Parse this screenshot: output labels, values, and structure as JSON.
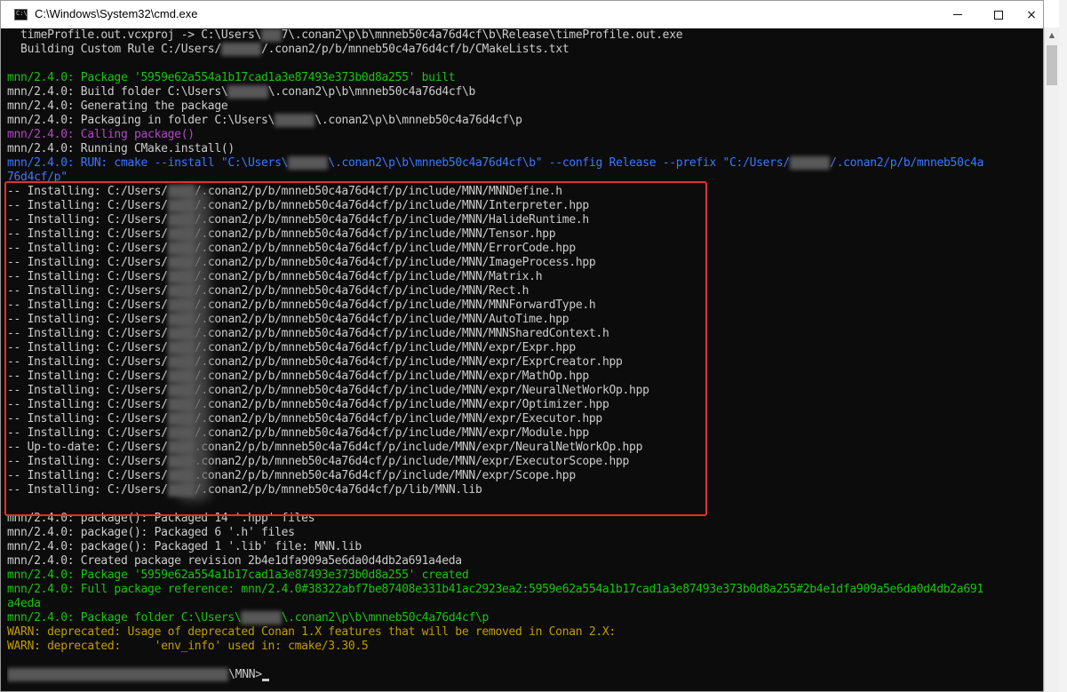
{
  "window": {
    "title": "C:\\Windows\\System32\\cmd.exe",
    "icon_label": "C:\\",
    "controls": {
      "minimize": "minimize-icon",
      "maximize": "maximize-icon",
      "close": "×"
    }
  },
  "console": {
    "lines": [
      [
        {
          "t": "  timeProfile.out.vcxproj -> C:\\Users\\",
          "c": "gray"
        },
        {
          "b": 3
        },
        {
          "t": "7\\.conan2\\p\\b\\mnneb50c4a76d4cf\\b\\Release\\timeProfile.out.exe",
          "c": "gray"
        }
      ],
      [
        {
          "t": "  Building Custom Rule C:/Users/",
          "c": "gray"
        },
        {
          "b": 6
        },
        {
          "t": "/.conan2/p/b/mnneb50c4a76d4cf/b/CMakeLists.txt",
          "c": "gray"
        }
      ],
      [],
      [
        {
          "t": "mnn/2.4.0: Package '5959e62a554a1b17cad1a3e87493e373b0d8a255' built",
          "c": "green"
        }
      ],
      [
        {
          "t": "mnn/2.4.0: Build folder C:\\Users\\",
          "c": "gray"
        },
        {
          "b": 6
        },
        {
          "t": "\\.conan2\\p\\b\\mnneb50c4a76d4cf\\b",
          "c": "gray"
        }
      ],
      [
        {
          "t": "mnn/2.4.0: Generating the package",
          "c": "gray"
        }
      ],
      [
        {
          "t": "mnn/2.4.0: Packaging in folder C:\\Users\\",
          "c": "gray"
        },
        {
          "b": 6
        },
        {
          "t": "\\.conan2\\p\\b\\mnneb50c4a76d4cf\\p",
          "c": "gray"
        }
      ],
      [
        {
          "t": "mnn/2.4.0: Calling package()",
          "c": "purple"
        }
      ],
      [
        {
          "t": "mnn/2.4.0: Running CMake.install()",
          "c": "gray"
        }
      ],
      [
        {
          "t": "mnn/2.4.0: RUN: cmake --install \"C:\\Users\\",
          "c": "blue"
        },
        {
          "b": 6
        },
        {
          "t": "\\.conan2\\p\\b\\mnneb50c4a76d4cf\\b\" --config Release --prefix \"C:/Users/",
          "c": "blue"
        },
        {
          "b": 6
        },
        {
          "t": "/.conan2/p/b/mnneb50c4a",
          "c": "blue"
        }
      ],
      [
        {
          "t": "76d4cf/p\"",
          "c": "blue"
        }
      ],
      [
        {
          "t": "-- Installing: C:/Users/",
          "c": "gray"
        },
        {
          "b": 4
        },
        {
          "t": "/.conan2/p/b/mnneb50c4a76d4cf/p/include/MNN/MNNDefine.h",
          "c": "gray"
        }
      ],
      [
        {
          "t": "-- Installing: C:/Users/",
          "c": "gray"
        },
        {
          "b": 4
        },
        {
          "t": "/.conan2/p/b/mnneb50c4a76d4cf/p/include/MNN/Interpreter.hpp",
          "c": "gray"
        }
      ],
      [
        {
          "t": "-- Installing: C:/Users/",
          "c": "gray"
        },
        {
          "b": 4
        },
        {
          "t": "/.conan2/p/b/mnneb50c4a76d4cf/p/include/MNN/HalideRuntime.h",
          "c": "gray"
        }
      ],
      [
        {
          "t": "-- Installing: C:/Users/",
          "c": "gray"
        },
        {
          "b": 4
        },
        {
          "t": "/.conan2/p/b/mnneb50c4a76d4cf/p/include/MNN/Tensor.hpp",
          "c": "gray"
        }
      ],
      [
        {
          "t": "-- Installing: C:/Users/",
          "c": "gray"
        },
        {
          "b": 4
        },
        {
          "t": "/.conan2/p/b/mnneb50c4a76d4cf/p/include/MNN/ErrorCode.hpp",
          "c": "gray"
        }
      ],
      [
        {
          "t": "-- Installing: C:/Users/",
          "c": "gray"
        },
        {
          "b": 4
        },
        {
          "t": "/.conan2/p/b/mnneb50c4a76d4cf/p/include/MNN/ImageProcess.hpp",
          "c": "gray"
        }
      ],
      [
        {
          "t": "-- Installing: C:/Users/",
          "c": "gray"
        },
        {
          "b": 4
        },
        {
          "t": "/.conan2/p/b/mnneb50c4a76d4cf/p/include/MNN/Matrix.h",
          "c": "gray"
        }
      ],
      [
        {
          "t": "-- Installing: C:/Users/",
          "c": "gray"
        },
        {
          "b": 4
        },
        {
          "t": "/.conan2/p/b/mnneb50c4a76d4cf/p/include/MNN/Rect.h",
          "c": "gray"
        }
      ],
      [
        {
          "t": "-- Installing: C:/Users/",
          "c": "gray"
        },
        {
          "b": 4
        },
        {
          "t": "/.conan2/p/b/mnneb50c4a76d4cf/p/include/MNN/MNNForwardType.h",
          "c": "gray"
        }
      ],
      [
        {
          "t": "-- Installing: C:/Users/",
          "c": "gray"
        },
        {
          "b": 4
        },
        {
          "t": "/.conan2/p/b/mnneb50c4a76d4cf/p/include/MNN/AutoTime.hpp",
          "c": "gray"
        }
      ],
      [
        {
          "t": "-- Installing: C:/Users/",
          "c": "gray"
        },
        {
          "b": 4
        },
        {
          "t": "/.conan2/p/b/mnneb50c4a76d4cf/p/include/MNN/MNNSharedContext.h",
          "c": "gray"
        }
      ],
      [
        {
          "t": "-- Installing: C:/Users/",
          "c": "gray"
        },
        {
          "b": 4
        },
        {
          "t": "/.conan2/p/b/mnneb50c4a76d4cf/p/include/MNN/expr/Expr.hpp",
          "c": "gray"
        }
      ],
      [
        {
          "t": "-- Installing: C:/Users/",
          "c": "gray"
        },
        {
          "b": 4
        },
        {
          "t": "/.conan2/p/b/mnneb50c4a76d4cf/p/include/MNN/expr/ExprCreator.hpp",
          "c": "gray"
        }
      ],
      [
        {
          "t": "-- Installing: C:/Users/",
          "c": "gray"
        },
        {
          "b": 4
        },
        {
          "t": "/.conan2/p/b/mnneb50c4a76d4cf/p/include/MNN/expr/MathOp.hpp",
          "c": "gray"
        }
      ],
      [
        {
          "t": "-- Installing: C:/Users/",
          "c": "gray"
        },
        {
          "b": 4
        },
        {
          "t": "/.conan2/p/b/mnneb50c4a76d4cf/p/include/MNN/expr/NeuralNetWorkOp.hpp",
          "c": "gray"
        }
      ],
      [
        {
          "t": "-- Installing: C:/Users/",
          "c": "gray"
        },
        {
          "b": 4
        },
        {
          "t": "/.conan2/p/b/mnneb50c4a76d4cf/p/include/MNN/expr/Optimizer.hpp",
          "c": "gray"
        }
      ],
      [
        {
          "t": "-- Installing: C:/Users/",
          "c": "gray"
        },
        {
          "b": 4
        },
        {
          "t": "/.conan2/p/b/mnneb50c4a76d4cf/p/include/MNN/expr/Executor.hpp",
          "c": "gray"
        }
      ],
      [
        {
          "t": "-- Installing: C:/Users/",
          "c": "gray"
        },
        {
          "b": 4
        },
        {
          "t": "/.conan2/p/b/mnneb50c4a76d4cf/p/include/MNN/expr/Module.hpp",
          "c": "gray"
        }
      ],
      [
        {
          "t": "-- Up-to-date: C:/Users/",
          "c": "gray"
        },
        {
          "b": 4
        },
        {
          "t": ".conan2/p/b/mnneb50c4a76d4cf/p/include/MNN/expr/NeuralNetWorkOp.hpp",
          "c": "gray"
        }
      ],
      [
        {
          "t": "-- Installing: C:/Users/",
          "c": "gray"
        },
        {
          "b": 4
        },
        {
          "t": ".conan2/p/b/mnneb50c4a76d4cf/p/include/MNN/expr/ExecutorScope.hpp",
          "c": "gray"
        }
      ],
      [
        {
          "t": "-- Installing: C:/Users/",
          "c": "gray"
        },
        {
          "b": 4
        },
        {
          "t": ".conan2/p/b/mnneb50c4a76d4cf/p/include/MNN/expr/Scope.hpp",
          "c": "gray"
        }
      ],
      [
        {
          "t": "-- Installing: C:/Users/",
          "c": "gray"
        },
        {
          "b": 4
        },
        {
          "t": "/.conan2/p/b/mnneb50c4a76d4cf/p/lib/MNN.lib",
          "c": "gray"
        }
      ],
      [],
      [
        {
          "t": "mnn/2.4.0: package(): Packaged 14 '.hpp' files",
          "c": "gray"
        }
      ],
      [
        {
          "t": "mnn/2.4.0: package(): Packaged 6 '.h' files",
          "c": "gray"
        }
      ],
      [
        {
          "t": "mnn/2.4.0: package(): Packaged 1 '.lib' file: MNN.lib",
          "c": "gray"
        }
      ],
      [
        {
          "t": "mnn/2.4.0: Created package revision 2b4e1dfa909a5e6da0d4db2a691a4eda",
          "c": "gray"
        }
      ],
      [
        {
          "t": "mnn/2.4.0: Package '5959e62a554a1b17cad1a3e87493e373b0d8a255' created",
          "c": "green"
        }
      ],
      [
        {
          "t": "mnn/2.4.0: Full package reference: mnn/2.4.0#38322abf7be87408e331b41ac2923ea2:5959e62a554a1b17cad1a3e87493e373b0d8a255#2b4e1dfa909a5e6da0d4db2a691",
          "c": "green"
        }
      ],
      [
        {
          "t": "a4eda",
          "c": "green"
        }
      ],
      [
        {
          "t": "mnn/2.4.0: Package folder C:\\Users\\",
          "c": "green"
        },
        {
          "b": 6
        },
        {
          "t": "\\.conan2\\p\\b\\mnneb50c4a76d4cf\\p",
          "c": "green"
        }
      ],
      [
        {
          "t": "WARN: deprecated: Usage of deprecated Conan 1.X features that will be removed in Conan 2.X:",
          "c": "yellow"
        }
      ],
      [
        {
          "t": "WARN: deprecated:     'env_info' used in: cmake/3.30.5",
          "c": "yellow"
        }
      ],
      [],
      [
        {
          "b": 33
        },
        {
          "t": "\\MNN>",
          "c": "gray"
        },
        {
          "cursor": true
        }
      ]
    ]
  },
  "scrollbar": {
    "up_arrow": "▲"
  },
  "colors": {
    "console_bg": "#0c0c0c",
    "text_gray": "#cccccc",
    "text_green": "#16c60c",
    "text_purple": "#b148c6",
    "text_blue": "#3b78ff",
    "text_yellow": "#c19c00",
    "highlight_red": "#e03131"
  }
}
